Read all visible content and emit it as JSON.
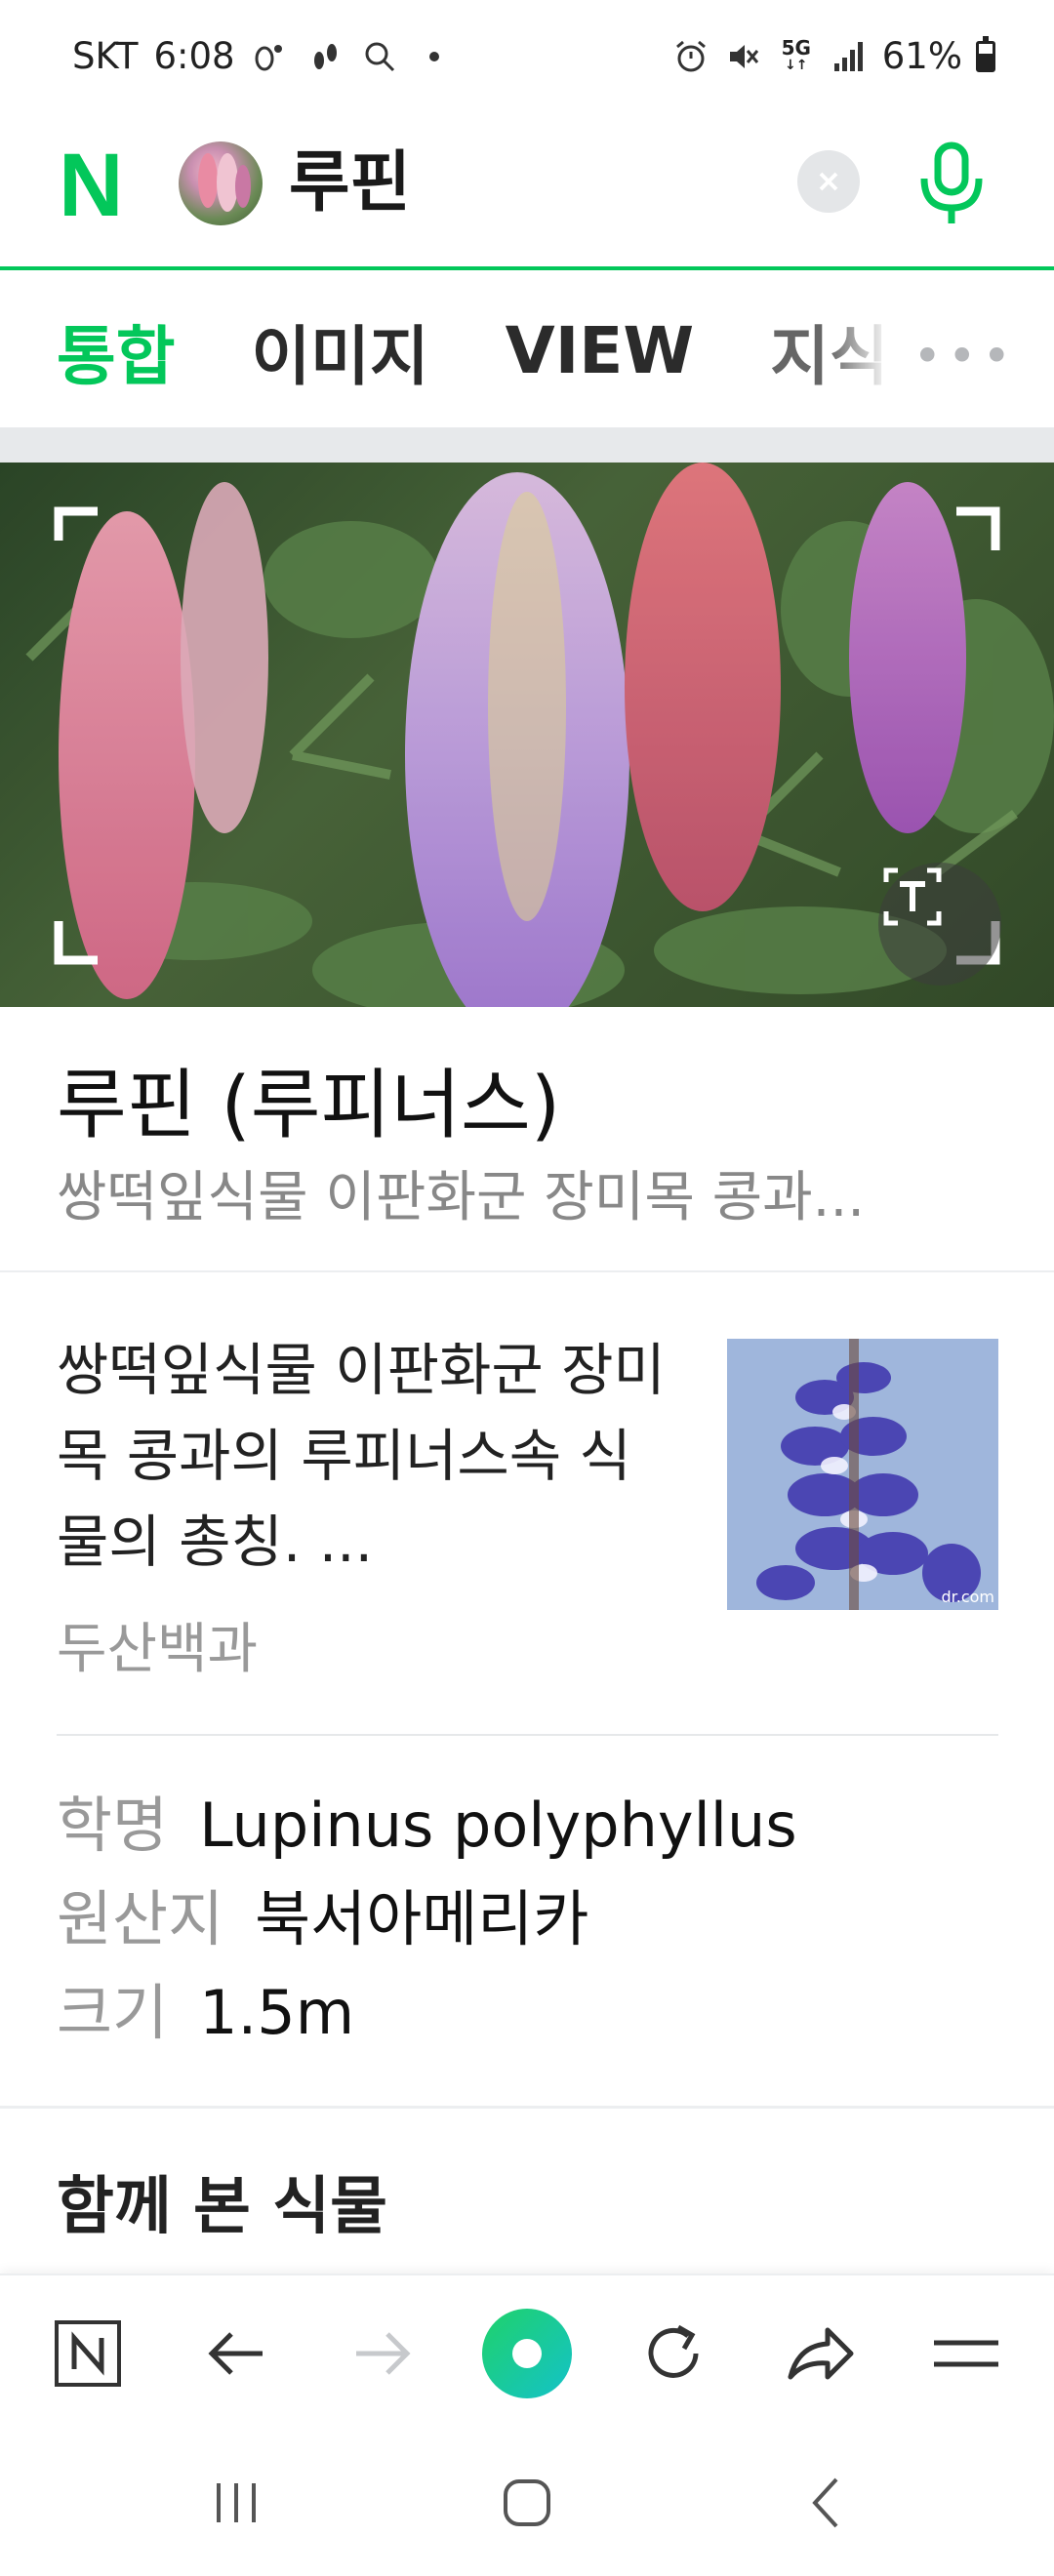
{
  "status_bar": {
    "carrier": "SKT",
    "time": "6:08",
    "battery": "61%",
    "network": "5G",
    "icons": [
      "footprint-icon",
      "walk-icon",
      "search-icon",
      "dot-icon",
      "alarm-icon",
      "mute-icon",
      "5g-icon",
      "signal-icon",
      "battery-icon"
    ]
  },
  "search": {
    "logo": "N",
    "query": "루핀",
    "clear_icon": "close-icon",
    "mic_icon": "mic-icon"
  },
  "tabs": [
    {
      "label": "통합",
      "active": true
    },
    {
      "label": "이미지",
      "active": false
    },
    {
      "label": "VIEW",
      "active": false
    },
    {
      "label": "지식",
      "active": false
    }
  ],
  "more_label": "•••",
  "result": {
    "title": "루핀 (루피너스)",
    "subtitle": "쌍떡잎식물 이판화군 장미목 콩과...",
    "description": "쌍떡잎식물 이판화군 장미목 콩과의 루피너스속 식물의 총칭. ...",
    "source": "두산백과",
    "thumb_watermark": "dr.com",
    "info": [
      {
        "label": "학명",
        "value": "Lupinus polyphyllus"
      },
      {
        "label": "원산지",
        "value": "북서아메리카"
      },
      {
        "label": "크기",
        "value": "1.5m"
      }
    ]
  },
  "related_heading": "함께 본 식물",
  "colors": {
    "brand_green": "#03c75a",
    "text_gray": "#999999"
  },
  "toolbar": {
    "icons": [
      "naver-home-icon",
      "back-arrow-icon",
      "forward-arrow-icon",
      "green-dot-icon",
      "refresh-icon",
      "share-icon",
      "menu-icon"
    ]
  },
  "system_nav": {
    "icons": [
      "recents-icon",
      "home-icon",
      "back-icon"
    ]
  }
}
